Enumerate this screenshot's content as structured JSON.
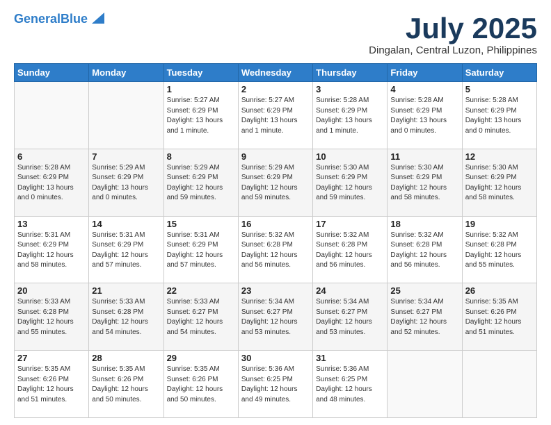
{
  "header": {
    "logo_line1": "General",
    "logo_line2": "Blue",
    "month_title": "July 2025",
    "location": "Dingalan, Central Luzon, Philippines"
  },
  "weekdays": [
    "Sunday",
    "Monday",
    "Tuesday",
    "Wednesday",
    "Thursday",
    "Friday",
    "Saturday"
  ],
  "weeks": [
    [
      {
        "day": "",
        "info": ""
      },
      {
        "day": "",
        "info": ""
      },
      {
        "day": "1",
        "info": "Sunrise: 5:27 AM\nSunset: 6:29 PM\nDaylight: 13 hours\nand 1 minute."
      },
      {
        "day": "2",
        "info": "Sunrise: 5:27 AM\nSunset: 6:29 PM\nDaylight: 13 hours\nand 1 minute."
      },
      {
        "day": "3",
        "info": "Sunrise: 5:28 AM\nSunset: 6:29 PM\nDaylight: 13 hours\nand 1 minute."
      },
      {
        "day": "4",
        "info": "Sunrise: 5:28 AM\nSunset: 6:29 PM\nDaylight: 13 hours\nand 0 minutes."
      },
      {
        "day": "5",
        "info": "Sunrise: 5:28 AM\nSunset: 6:29 PM\nDaylight: 13 hours\nand 0 minutes."
      }
    ],
    [
      {
        "day": "6",
        "info": "Sunrise: 5:28 AM\nSunset: 6:29 PM\nDaylight: 13 hours\nand 0 minutes."
      },
      {
        "day": "7",
        "info": "Sunrise: 5:29 AM\nSunset: 6:29 PM\nDaylight: 13 hours\nand 0 minutes."
      },
      {
        "day": "8",
        "info": "Sunrise: 5:29 AM\nSunset: 6:29 PM\nDaylight: 12 hours\nand 59 minutes."
      },
      {
        "day": "9",
        "info": "Sunrise: 5:29 AM\nSunset: 6:29 PM\nDaylight: 12 hours\nand 59 minutes."
      },
      {
        "day": "10",
        "info": "Sunrise: 5:30 AM\nSunset: 6:29 PM\nDaylight: 12 hours\nand 59 minutes."
      },
      {
        "day": "11",
        "info": "Sunrise: 5:30 AM\nSunset: 6:29 PM\nDaylight: 12 hours\nand 58 minutes."
      },
      {
        "day": "12",
        "info": "Sunrise: 5:30 AM\nSunset: 6:29 PM\nDaylight: 12 hours\nand 58 minutes."
      }
    ],
    [
      {
        "day": "13",
        "info": "Sunrise: 5:31 AM\nSunset: 6:29 PM\nDaylight: 12 hours\nand 58 minutes."
      },
      {
        "day": "14",
        "info": "Sunrise: 5:31 AM\nSunset: 6:29 PM\nDaylight: 12 hours\nand 57 minutes."
      },
      {
        "day": "15",
        "info": "Sunrise: 5:31 AM\nSunset: 6:29 PM\nDaylight: 12 hours\nand 57 minutes."
      },
      {
        "day": "16",
        "info": "Sunrise: 5:32 AM\nSunset: 6:28 PM\nDaylight: 12 hours\nand 56 minutes."
      },
      {
        "day": "17",
        "info": "Sunrise: 5:32 AM\nSunset: 6:28 PM\nDaylight: 12 hours\nand 56 minutes."
      },
      {
        "day": "18",
        "info": "Sunrise: 5:32 AM\nSunset: 6:28 PM\nDaylight: 12 hours\nand 56 minutes."
      },
      {
        "day": "19",
        "info": "Sunrise: 5:32 AM\nSunset: 6:28 PM\nDaylight: 12 hours\nand 55 minutes."
      }
    ],
    [
      {
        "day": "20",
        "info": "Sunrise: 5:33 AM\nSunset: 6:28 PM\nDaylight: 12 hours\nand 55 minutes."
      },
      {
        "day": "21",
        "info": "Sunrise: 5:33 AM\nSunset: 6:28 PM\nDaylight: 12 hours\nand 54 minutes."
      },
      {
        "day": "22",
        "info": "Sunrise: 5:33 AM\nSunset: 6:27 PM\nDaylight: 12 hours\nand 54 minutes."
      },
      {
        "day": "23",
        "info": "Sunrise: 5:34 AM\nSunset: 6:27 PM\nDaylight: 12 hours\nand 53 minutes."
      },
      {
        "day": "24",
        "info": "Sunrise: 5:34 AM\nSunset: 6:27 PM\nDaylight: 12 hours\nand 53 minutes."
      },
      {
        "day": "25",
        "info": "Sunrise: 5:34 AM\nSunset: 6:27 PM\nDaylight: 12 hours\nand 52 minutes."
      },
      {
        "day": "26",
        "info": "Sunrise: 5:35 AM\nSunset: 6:26 PM\nDaylight: 12 hours\nand 51 minutes."
      }
    ],
    [
      {
        "day": "27",
        "info": "Sunrise: 5:35 AM\nSunset: 6:26 PM\nDaylight: 12 hours\nand 51 minutes."
      },
      {
        "day": "28",
        "info": "Sunrise: 5:35 AM\nSunset: 6:26 PM\nDaylight: 12 hours\nand 50 minutes."
      },
      {
        "day": "29",
        "info": "Sunrise: 5:35 AM\nSunset: 6:26 PM\nDaylight: 12 hours\nand 50 minutes."
      },
      {
        "day": "30",
        "info": "Sunrise: 5:36 AM\nSunset: 6:25 PM\nDaylight: 12 hours\nand 49 minutes."
      },
      {
        "day": "31",
        "info": "Sunrise: 5:36 AM\nSunset: 6:25 PM\nDaylight: 12 hours\nand 48 minutes."
      },
      {
        "day": "",
        "info": ""
      },
      {
        "day": "",
        "info": ""
      }
    ]
  ]
}
